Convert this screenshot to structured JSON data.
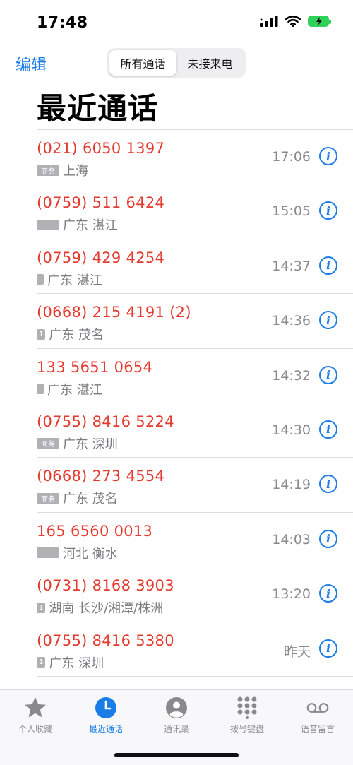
{
  "status_bar": {
    "time": "17:48"
  },
  "nav": {
    "edit_label": "编辑",
    "segments": [
      "所有通话",
      "未接来电"
    ],
    "active_segment": 0
  },
  "title": "最近通话",
  "calls": [
    {
      "number": "(021) 6050 1397",
      "badge": "商务",
      "location": "上海",
      "time": "17:06"
    },
    {
      "number": "(0759) 511 6424",
      "badge": "",
      "location": "广东 湛江",
      "time": "15:05"
    },
    {
      "number": "(0759) 429 4254",
      "badge": "",
      "location": "广东 湛江",
      "time": "14:37"
    },
    {
      "number": "(0668) 215 4191 (2)",
      "badge": "1",
      "location": "广东 茂名",
      "time": "14:36"
    },
    {
      "number": "133 5651 0654",
      "badge": "",
      "location": "广东 湛江",
      "time": "14:32"
    },
    {
      "number": "(0755) 8416 5224",
      "badge": "商务",
      "location": "广东 深圳",
      "time": "14:30"
    },
    {
      "number": "(0668) 273 4554",
      "badge": "商务",
      "location": "广东 茂名",
      "time": "14:19"
    },
    {
      "number": "165 6560 0013",
      "badge": "",
      "location": "河北 衡水",
      "time": "14:03"
    },
    {
      "number": "(0731) 8168 3903",
      "badge": "1",
      "location": "湖南 长沙/湘潭/株洲",
      "time": "13:20"
    },
    {
      "number": "(0755) 8416 5380",
      "badge": "1",
      "location": "广东 深圳",
      "time": "昨天"
    }
  ],
  "tabs": [
    {
      "label": "个人收藏",
      "icon": "star-icon"
    },
    {
      "label": "最近通话",
      "icon": "clock-icon"
    },
    {
      "label": "通讯录",
      "icon": "contact-icon"
    },
    {
      "label": "拨号键盘",
      "icon": "keypad-icon"
    },
    {
      "label": "语音留言",
      "icon": "voicemail-icon"
    }
  ],
  "active_tab": 1,
  "colors": {
    "accent": "#1a7ce6",
    "missed": "#e23b30",
    "battery": "#2fd158"
  }
}
